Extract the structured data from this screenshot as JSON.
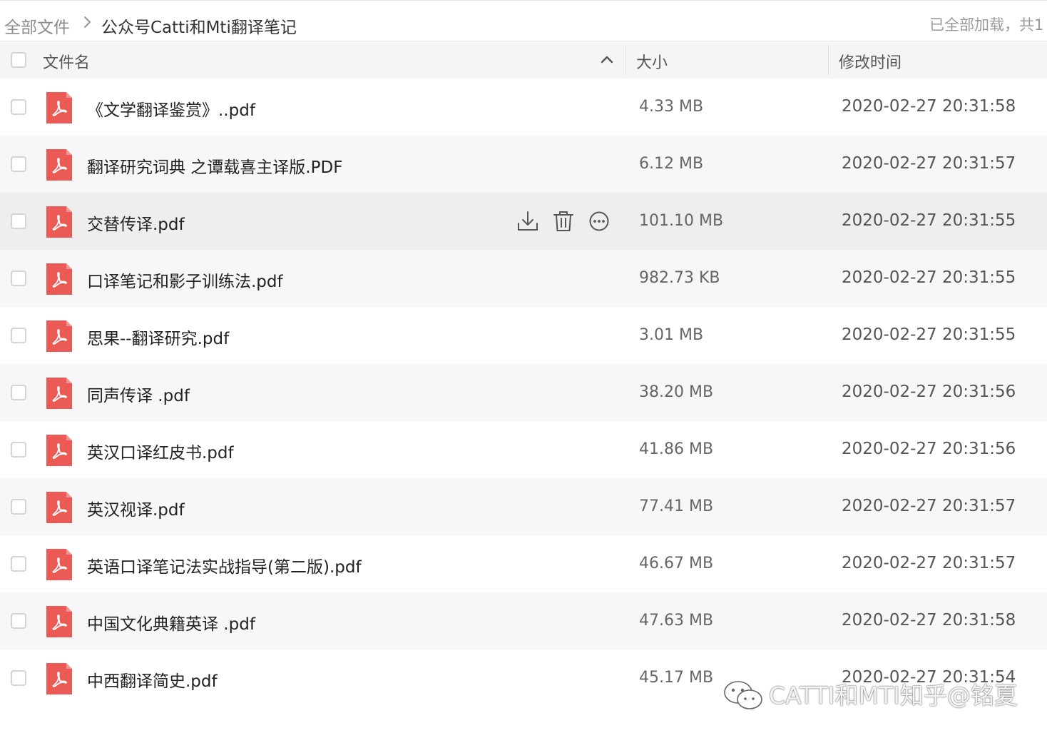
{
  "breadcrumb": {
    "root": "全部文件",
    "current": "公众号Catti和Mti翻译笔记",
    "status": "已全部加载，共1"
  },
  "columns": {
    "name": "文件名",
    "size": "大小",
    "modified": "修改时间"
  },
  "files": [
    {
      "name": "《文学翻译鉴赏》..pdf",
      "size": "4.33 MB",
      "modified": "2020-02-27 20:31:58"
    },
    {
      "name": "翻译研究词典 之谭载喜主译版.PDF",
      "size": "6.12 MB",
      "modified": "2020-02-27 20:31:57"
    },
    {
      "name": "交替传译.pdf",
      "size": "101.10 MB",
      "modified": "2020-02-27 20:31:55"
    },
    {
      "name": "口译笔记和影子训练法.pdf",
      "size": "982.73 KB",
      "modified": "2020-02-27 20:31:55"
    },
    {
      "name": "思果--翻译研究.pdf",
      "size": "3.01 MB",
      "modified": "2020-02-27 20:31:55"
    },
    {
      "name": "同声传译 .pdf",
      "size": "38.20 MB",
      "modified": "2020-02-27 20:31:56"
    },
    {
      "name": "英汉口译红皮书.pdf",
      "size": "41.86 MB",
      "modified": "2020-02-27 20:31:56"
    },
    {
      "name": "英汉视译.pdf",
      "size": "77.41 MB",
      "modified": "2020-02-27 20:31:57"
    },
    {
      "name": "英语口译笔记法实战指导(第二版).pdf",
      "size": "46.67 MB",
      "modified": "2020-02-27 20:31:57"
    },
    {
      "name": "中国文化典籍英译 .pdf",
      "size": "47.63 MB",
      "modified": "2020-02-27 20:31:58"
    },
    {
      "name": "中西翻译简史.pdf",
      "size": "45.17 MB",
      "modified": "2020-02-27 20:31:54"
    }
  ],
  "hovered_row_index": 2,
  "row_actions": [
    "download-icon",
    "trash-icon",
    "more-icon"
  ],
  "file_icon": "pdf-file-icon",
  "colors": {
    "pdf_red": "#ec5a55",
    "row_alt": "#f7f7f7",
    "row_hover": "#eeeeee",
    "header_bg": "#f5f5f5"
  },
  "watermark": {
    "text": "CATTI和MTI知乎@铭夏"
  }
}
